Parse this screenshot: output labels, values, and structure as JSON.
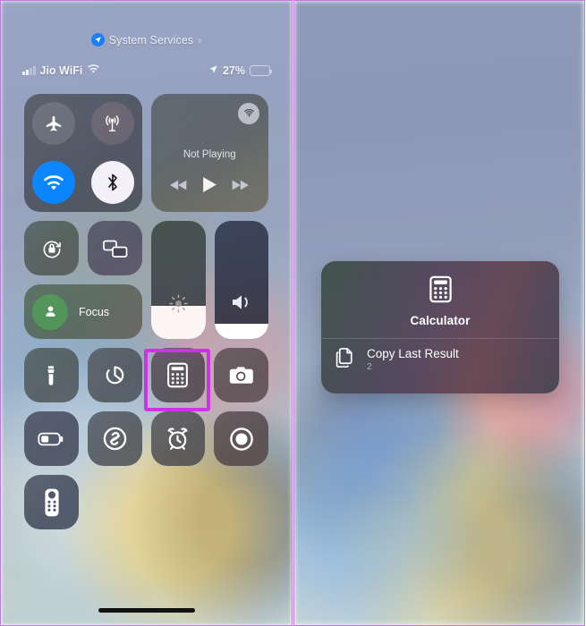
{
  "theme": {
    "highlight_color": "#cc33e6",
    "accent_blue": "#0a84ff",
    "focus_green": "#4e9254"
  },
  "left_panel": {
    "header": {
      "location_icon": "location-arrow-icon",
      "label": "System Services",
      "chevron": "›"
    },
    "status_bar": {
      "signal_icon": "cellular-bars-icon",
      "carrier": "Jio WiFi",
      "wifi_icon": "wifi-icon",
      "location_icon": "location-arrow-icon",
      "battery_percent": "27%",
      "battery_fill": 27
    },
    "connectivity": [
      {
        "name": "airplane-mode",
        "icon": "airplane-icon",
        "active": false
      },
      {
        "name": "cellular-data",
        "icon": "cellular-antenna-icon",
        "active": false
      },
      {
        "name": "wifi",
        "icon": "wifi-icon",
        "active": true
      },
      {
        "name": "bluetooth",
        "icon": "bluetooth-icon",
        "active": true
      }
    ],
    "media": {
      "airplay_icon": "airplay-audio-icon",
      "status": "Not Playing",
      "controls": [
        "rewind-icon",
        "play-icon",
        "fast-forward-icon"
      ]
    },
    "mini_toggles": [
      {
        "name": "rotation-lock",
        "icon": "rotation-lock-icon"
      },
      {
        "name": "screen-mirroring",
        "icon": "screen-mirroring-icon"
      }
    ],
    "focus": {
      "icon": "person-icon",
      "label": "Focus"
    },
    "sliders": [
      {
        "name": "brightness-slider",
        "icon": "brightness-icon",
        "value": 28
      },
      {
        "name": "volume-slider",
        "icon": "speaker-wave-icon",
        "value": 13
      }
    ],
    "apps_row_1": [
      {
        "name": "flashlight",
        "icon": "flashlight-icon"
      },
      {
        "name": "timer",
        "icon": "timer-icon"
      },
      {
        "name": "calculator",
        "icon": "calculator-icon",
        "highlighted": true
      },
      {
        "name": "camera",
        "icon": "camera-icon"
      }
    ],
    "apps_row_2": [
      {
        "name": "low-power-mode",
        "icon": "battery-low-power-icon"
      },
      {
        "name": "shazam",
        "icon": "shazam-icon"
      },
      {
        "name": "alarm",
        "icon": "alarm-clock-icon"
      },
      {
        "name": "screen-recording",
        "icon": "record-icon"
      }
    ],
    "apps_row_3": [
      {
        "name": "apple-tv-remote",
        "icon": "tv-remote-icon"
      }
    ]
  },
  "right_panel": {
    "context_menu": {
      "app_icon": "calculator-icon",
      "title": "Calculator",
      "items": [
        {
          "name": "copy-last-result",
          "icon": "copy-documents-icon",
          "label": "Copy Last Result",
          "subtitle": "2",
          "highlighted": true
        }
      ]
    }
  }
}
